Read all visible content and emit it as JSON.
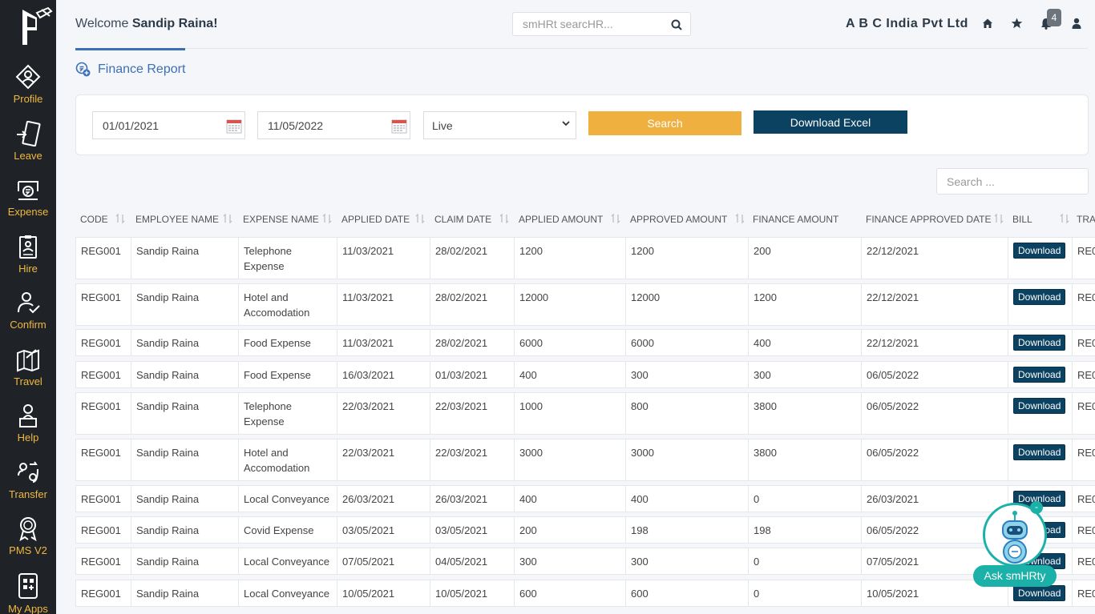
{
  "sidebar": {
    "items": [
      {
        "label": "Profile",
        "icon": "profile-icon"
      },
      {
        "label": "Leave",
        "icon": "leave-icon"
      },
      {
        "label": "Expense",
        "icon": "expense-icon"
      },
      {
        "label": "Hire",
        "icon": "hire-icon"
      },
      {
        "label": "Confirm",
        "icon": "confirm-icon"
      },
      {
        "label": "Travel",
        "icon": "travel-icon"
      },
      {
        "label": "Help",
        "icon": "help-icon"
      },
      {
        "label": "Transfer",
        "icon": "transfer-icon"
      },
      {
        "label": "PMS V2",
        "icon": "pms-icon"
      },
      {
        "label": "My Apps",
        "icon": "apps-icon"
      }
    ]
  },
  "header": {
    "welcome_prefix": "Welcome",
    "user_name": "Sandip Raina!",
    "search_placeholder": "smHRt searcHR...",
    "company": "A B C India Pvt Ltd",
    "notification_count": "4"
  },
  "page": {
    "title": "Finance Report"
  },
  "filters": {
    "from_date": "01/01/2021",
    "to_date": "11/05/2022",
    "status": "Live",
    "search_button": "Search",
    "excel_button": "Download Excel"
  },
  "table": {
    "search_placeholder": "Search ...",
    "columns": [
      "CODE",
      "EMPLOYEE NAME",
      "EXPENSE NAME",
      "APPLIED DATE",
      "CLAIM DATE",
      "APPLIED AMOUNT",
      "APPROVED AMOUNT",
      "FINANCE AMOUNT",
      "FINANCE APPROVED DATE",
      "BILL",
      "TRA"
    ],
    "download_label": "Download",
    "rows": [
      {
        "code": "REG001",
        "name": "Sandip Raina",
        "expense": "Telephone Expense",
        "applied": "11/03/2021",
        "claim": "28/02/2021",
        "applied_amt": "1200",
        "approved_amt": "1200",
        "finance_amt": "200",
        "finance_date": "22/12/2021",
        "tra": "RE0"
      },
      {
        "code": "REG001",
        "name": "Sandip Raina",
        "expense": "Hotel and Accomodation",
        "applied": "11/03/2021",
        "claim": "28/02/2021",
        "applied_amt": "12000",
        "approved_amt": "12000",
        "finance_amt": "1200",
        "finance_date": "22/12/2021",
        "tra": "RE0"
      },
      {
        "code": "REG001",
        "name": "Sandip Raina",
        "expense": "Food Expense",
        "applied": "11/03/2021",
        "claim": "28/02/2021",
        "applied_amt": "6000",
        "approved_amt": "6000",
        "finance_amt": "400",
        "finance_date": "22/12/2021",
        "tra": "RE0"
      },
      {
        "code": "REG001",
        "name": "Sandip Raina",
        "expense": "Food Expense",
        "applied": "16/03/2021",
        "claim": "01/03/2021",
        "applied_amt": "400",
        "approved_amt": "300",
        "finance_amt": "300",
        "finance_date": "06/05/2022",
        "tra": "RE0"
      },
      {
        "code": "REG001",
        "name": "Sandip Raina",
        "expense": "Telephone Expense",
        "applied": "22/03/2021",
        "claim": "22/03/2021",
        "applied_amt": "1000",
        "approved_amt": "800",
        "finance_amt": "3800",
        "finance_date": "06/05/2022",
        "tra": "RE0"
      },
      {
        "code": "REG001",
        "name": "Sandip Raina",
        "expense": "Hotel and Accomodation",
        "applied": "22/03/2021",
        "claim": "22/03/2021",
        "applied_amt": "3000",
        "approved_amt": "3000",
        "finance_amt": "3800",
        "finance_date": "06/05/2022",
        "tra": "RE0"
      },
      {
        "code": "REG001",
        "name": "Sandip Raina",
        "expense": "Local Conveyance",
        "applied": "26/03/2021",
        "claim": "26/03/2021",
        "applied_amt": "400",
        "approved_amt": "400",
        "finance_amt": "0",
        "finance_date": "26/03/2021",
        "tra": "RE0"
      },
      {
        "code": "REG001",
        "name": "Sandip Raina",
        "expense": "Covid Expense",
        "applied": "03/05/2021",
        "claim": "03/05/2021",
        "applied_amt": "200",
        "approved_amt": "198",
        "finance_amt": "198",
        "finance_date": "06/05/2022",
        "tra": "RE0"
      },
      {
        "code": "REG001",
        "name": "Sandip Raina",
        "expense": "Local Conveyance",
        "applied": "07/05/2021",
        "claim": "04/05/2021",
        "applied_amt": "300",
        "approved_amt": "300",
        "finance_amt": "0",
        "finance_date": "07/05/2021",
        "tra": "RE0"
      },
      {
        "code": "REG001",
        "name": "Sandip Raina",
        "expense": "Local Conveyance",
        "applied": "10/05/2021",
        "claim": "10/05/2021",
        "applied_amt": "600",
        "approved_amt": "600",
        "finance_amt": "0",
        "finance_date": "10/05/2021",
        "tra": "RE0"
      }
    ]
  },
  "chatbot": {
    "label": "Ask smHRty",
    "minimize": "-"
  },
  "colors": {
    "sidebar_bg": "#1f2327",
    "sidebar_label": "#f0b840",
    "accent_blue": "#3c6fb6",
    "search_button": "#efb040",
    "dark_button": "#0c4261",
    "chatbot_teal": "#1bb1a8"
  }
}
